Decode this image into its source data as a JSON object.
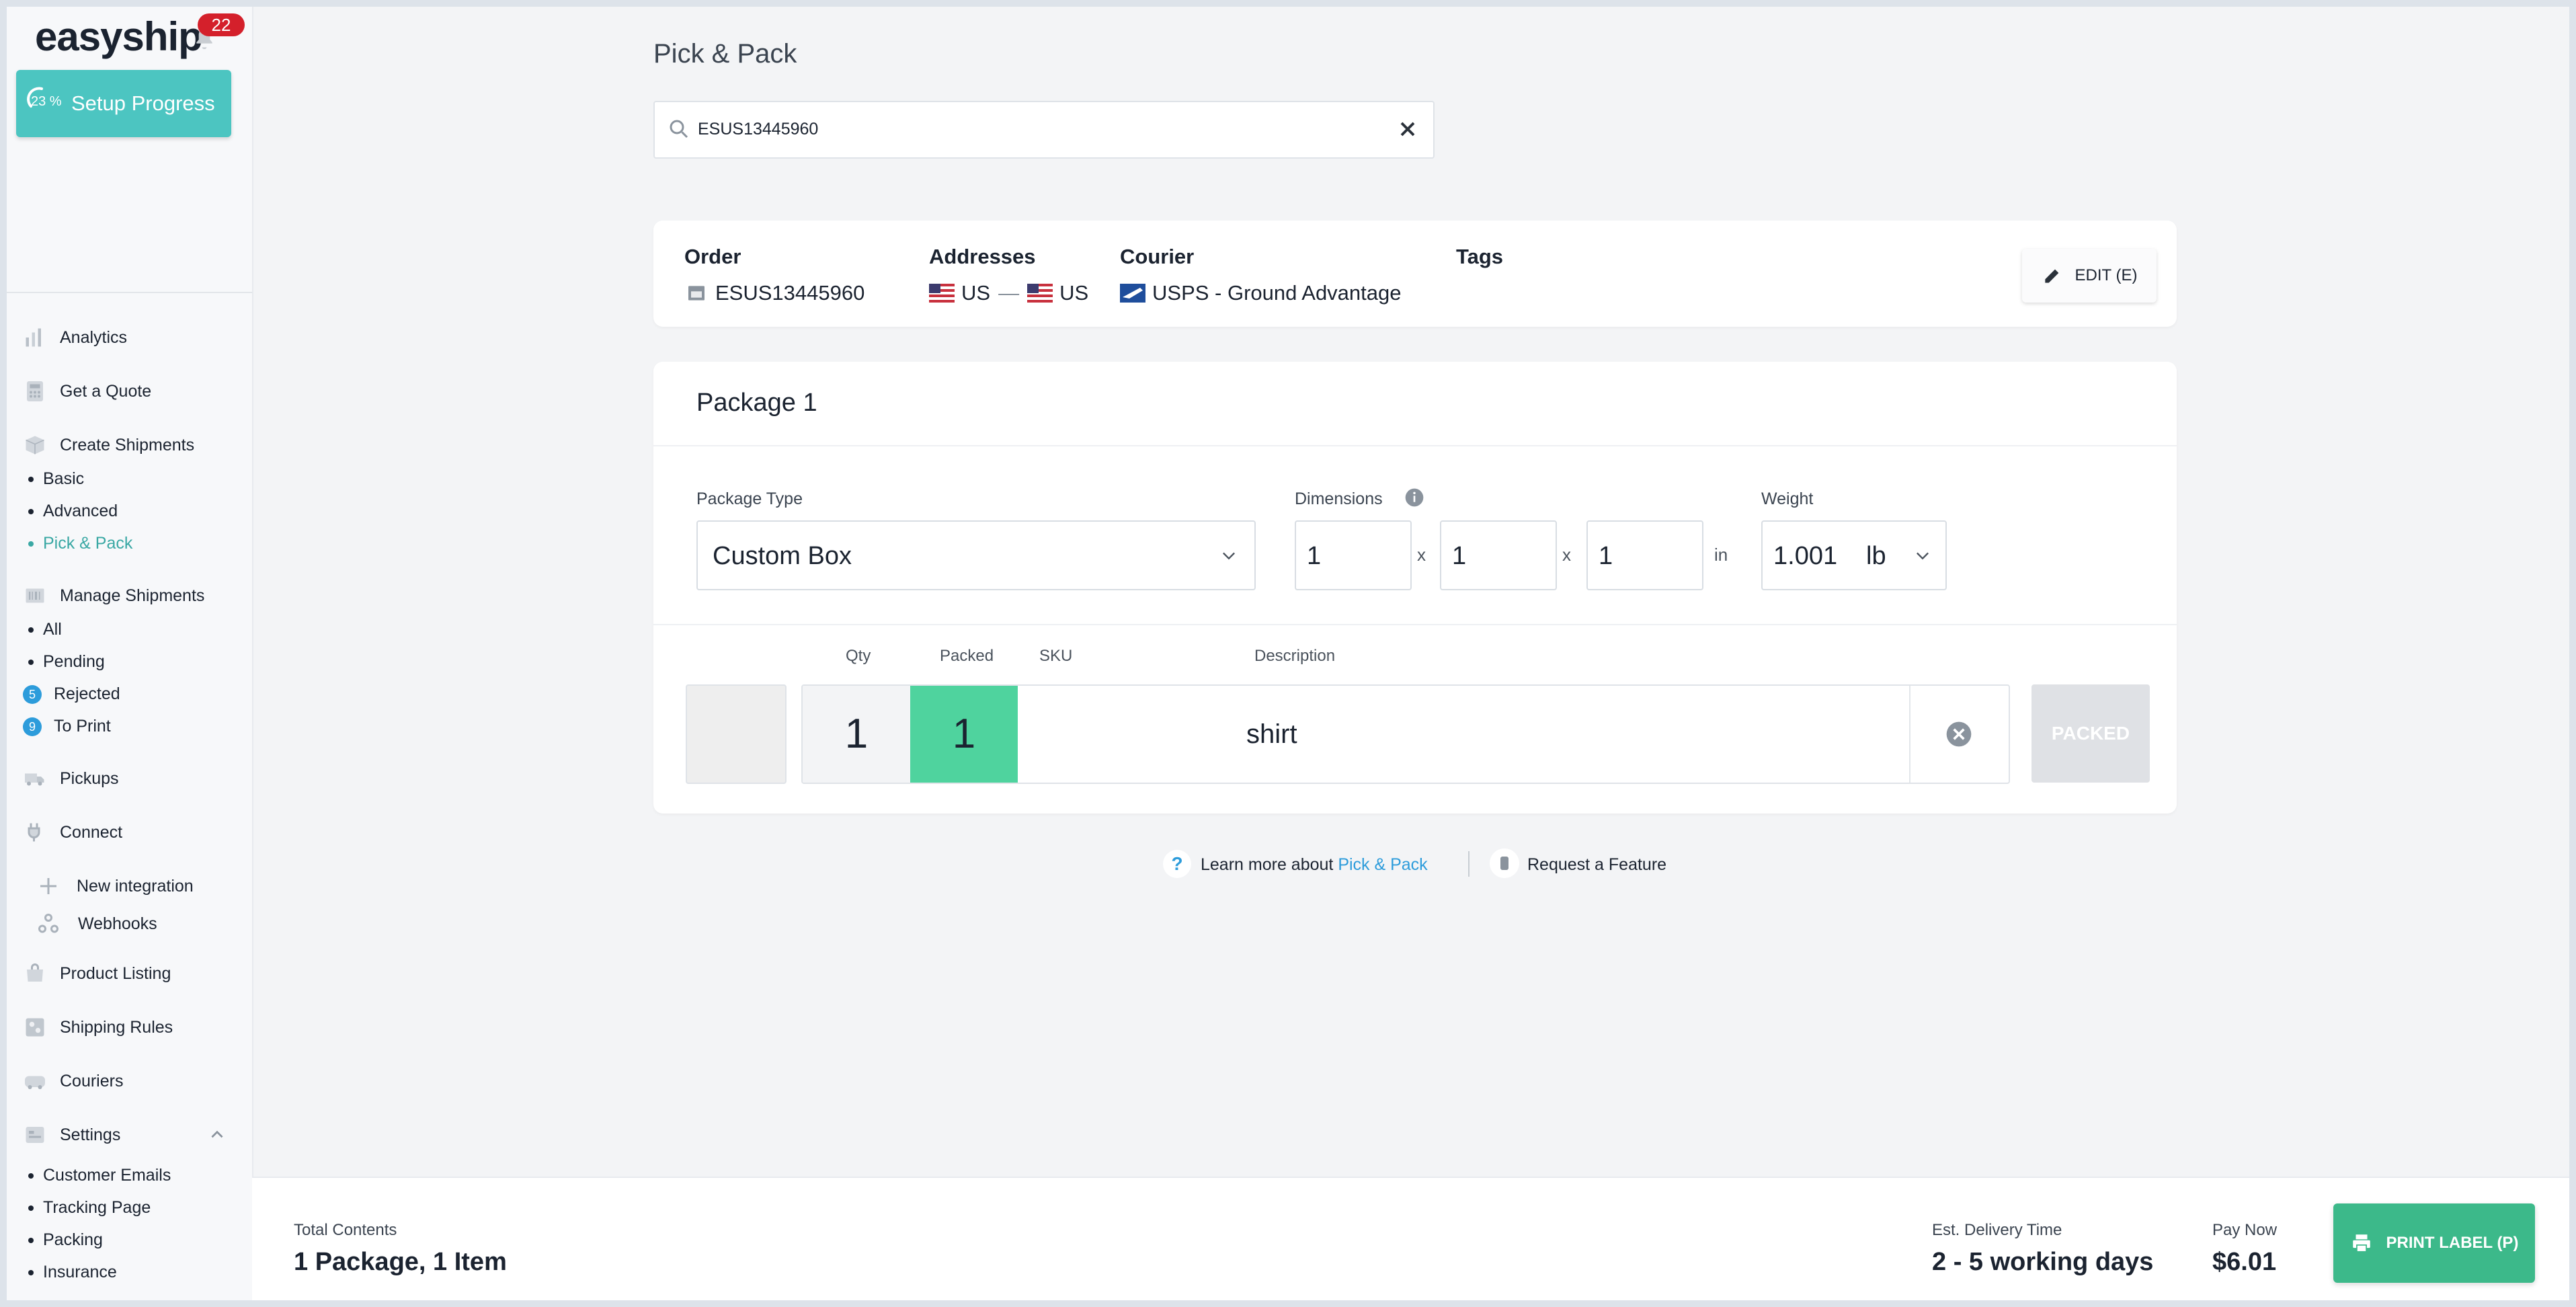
{
  "sidebar": {
    "logo": "easyship",
    "notifications": "22",
    "setup": {
      "percent": "23 %",
      "label": "Setup Progress"
    },
    "nav": {
      "analytics": "Analytics",
      "quote": "Get a Quote",
      "create": "Create Shipments",
      "create_sub": [
        "Basic",
        "Advanced",
        "Pick & Pack"
      ],
      "manage": "Manage Shipments",
      "manage_sub": [
        "All",
        "Pending",
        "Rejected",
        "To Print"
      ],
      "rejected_count": "5",
      "toprint_count": "9",
      "pickups": "Pickups",
      "connect": "Connect",
      "connect_sub": [
        "New integration",
        "Webhooks"
      ],
      "product_listing": "Product Listing",
      "shipping_rules": "Shipping Rules",
      "couriers": "Couriers",
      "settings": "Settings",
      "settings_sub": [
        "Customer Emails",
        "Tracking Page",
        "Packing",
        "Insurance"
      ]
    }
  },
  "main": {
    "title": "Pick & Pack",
    "search": {
      "value": "ESUS13445960"
    },
    "order": {
      "order_label": "Order",
      "order_id": "ESUS13445960",
      "addresses_label": "Addresses",
      "from": "US",
      "to": "US",
      "arrow": "—",
      "courier_label": "Courier",
      "courier": "USPS - Ground Advantage",
      "tags_label": "Tags",
      "edit": "EDIT (E)"
    },
    "package": {
      "title": "Package 1",
      "type_label": "Package Type",
      "type_value": "Custom Box",
      "dimensions_label": "Dimensions",
      "dims": [
        "1",
        "1",
        "1"
      ],
      "x": "x",
      "unit": "in",
      "weight_label": "Weight",
      "weight": "1.001",
      "weight_unit": "lb",
      "columns": {
        "qty": "Qty",
        "packed": "Packed",
        "sku": "SKU",
        "description": "Description"
      },
      "item": {
        "qty": "1",
        "packed": "1",
        "sku": "",
        "description": "shirt"
      },
      "packed_button": "PACKED"
    },
    "help": {
      "learn_prefix": "Learn more about",
      "learn_link": "Pick & Pack",
      "request": "Request a Feature"
    }
  },
  "footer": {
    "total_label": "Total Contents",
    "total_value": "1 Package, 1 Item",
    "delivery_label": "Est. Delivery Time",
    "delivery_value": "2 - 5 working days",
    "pay_label": "Pay Now",
    "pay_value": "$6.01",
    "print_button": "PRINT LABEL (P)"
  },
  "colors": {
    "accent": "#4cc5c1",
    "packed_green": "#4fd39e",
    "print_green": "#3cb98a",
    "link_blue": "#2d9cdb",
    "badge_red": "#d4202b"
  }
}
